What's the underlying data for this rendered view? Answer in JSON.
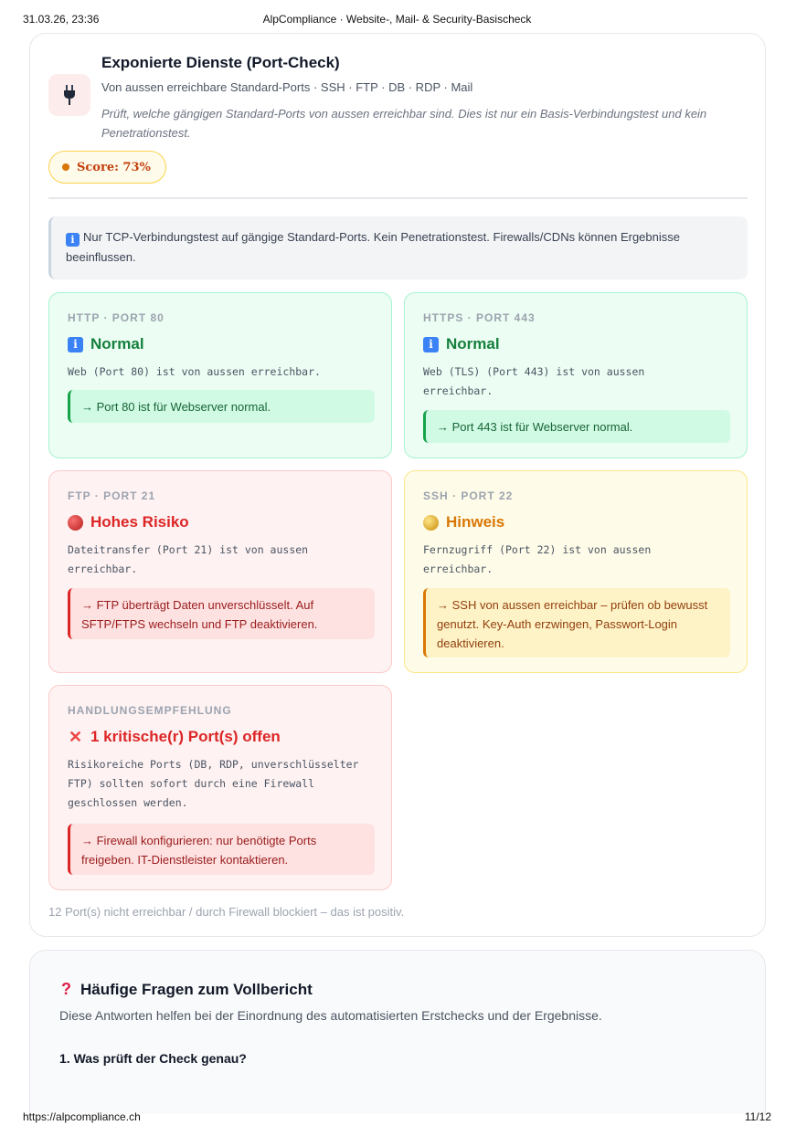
{
  "print": {
    "datetime": "31.03.26, 23:36",
    "doc_title": "AlpCompliance · Website-, Mail- & Security-Basischeck",
    "url": "https://alpcompliance.ch",
    "page": "11/12"
  },
  "section": {
    "icon": "plug-icon",
    "title": "Exponierte Dienste (Port-Check)",
    "subtitle": "Von aussen erreichbare Standard-Ports · SSH · FTP · DB · RDP · Mail",
    "description": "Prüft, welche gängigen Standard-Ports von aussen erreichbar sind. Dies ist nur ein Basis-Verbindungstest und kein Penetrationstest.",
    "score": "Score: 73%",
    "info": "Nur TCP-Verbindungstest auf gängige Standard-Ports. Kein Penetrationstest. Firewalls/CDNs können Ergebnisse beeinflussen.",
    "footnote": "12 Port(s) nicht erreichbar / durch Firewall blockiert – das ist positiv."
  },
  "ports": [
    {
      "label": "HTTP · PORT 80",
      "status": "Normal",
      "icon": "info-icon",
      "tone": "green",
      "description": "Web (Port 80) ist von aussen erreichbar.",
      "note": "→ Port 80 ist für Webserver normal."
    },
    {
      "label": "HTTPS · PORT 443",
      "status": "Normal",
      "icon": "info-icon",
      "tone": "green",
      "description": "Web (TLS) (Port 443) ist von aussen erreichbar.",
      "note": "→ Port 443 ist für Webserver normal."
    },
    {
      "label": "FTP · PORT 21",
      "status": "Hohes Risiko",
      "icon": "red-circle-icon",
      "tone": "red",
      "description": "Dateitransfer (Port 21) ist von aussen erreichbar.",
      "note": "→ FTP überträgt Daten unverschlüsselt. Auf SFTP/FTPS wechseln und FTP deaktivieren."
    },
    {
      "label": "SSH · PORT 22",
      "status": "Hinweis",
      "icon": "yellow-circle-icon",
      "tone": "yellow",
      "description": "Fernzugriff (Port 22) ist von aussen erreichbar.",
      "note": "→ SSH von aussen erreichbar – prüfen ob bewusst genutzt. Key-Auth erzwingen, Passwort-Login deaktivieren."
    },
    {
      "label": "HANDLUNGSEMPFEHLUNG",
      "status": "1 kritische(r) Port(s) offen",
      "icon": "cross-icon",
      "tone": "red",
      "description": "Risikoreiche Ports (DB, RDP, unverschlüsselter FTP) sollten sofort durch eine Firewall geschlossen werden.",
      "note": "→ Firewall konfigurieren: nur benötigte Ports freigeben. IT-Dienstleister kontaktieren."
    }
  ],
  "faq": {
    "icon": "question-icon",
    "title": "Häufige Fragen zum Vollbericht",
    "subtitle": "Diese Antworten helfen bei der Einordnung des automatisierten Erstchecks und der Ergebnisse.",
    "q1": "1. Was prüft der Check genau?"
  }
}
